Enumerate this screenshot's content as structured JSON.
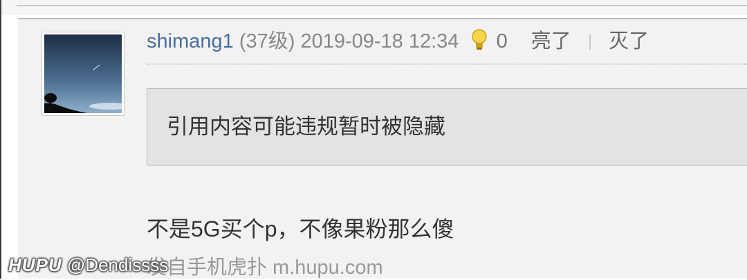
{
  "post": {
    "username": "shimang1",
    "level": "(37级)",
    "datetime": "2019-09-18 12:34",
    "light_count": "0",
    "light_up_label": "亮了",
    "light_down_label": "灭了",
    "separator": "|",
    "quote_text": "引用内容可能违规暂时被隐藏",
    "reply_text": "不是5G买个p，不像果粉那么傻",
    "source_text": "发自手机虎扑 m.hupu.com"
  },
  "watermark": {
    "brand": "HUPU",
    "handle": "@Dendissss"
  },
  "icons": {
    "light": "lightbulb-icon"
  },
  "colors": {
    "username": "#4a6f9a",
    "post_background": "#f2f2f2",
    "quote_background": "#e3e3e3"
  }
}
